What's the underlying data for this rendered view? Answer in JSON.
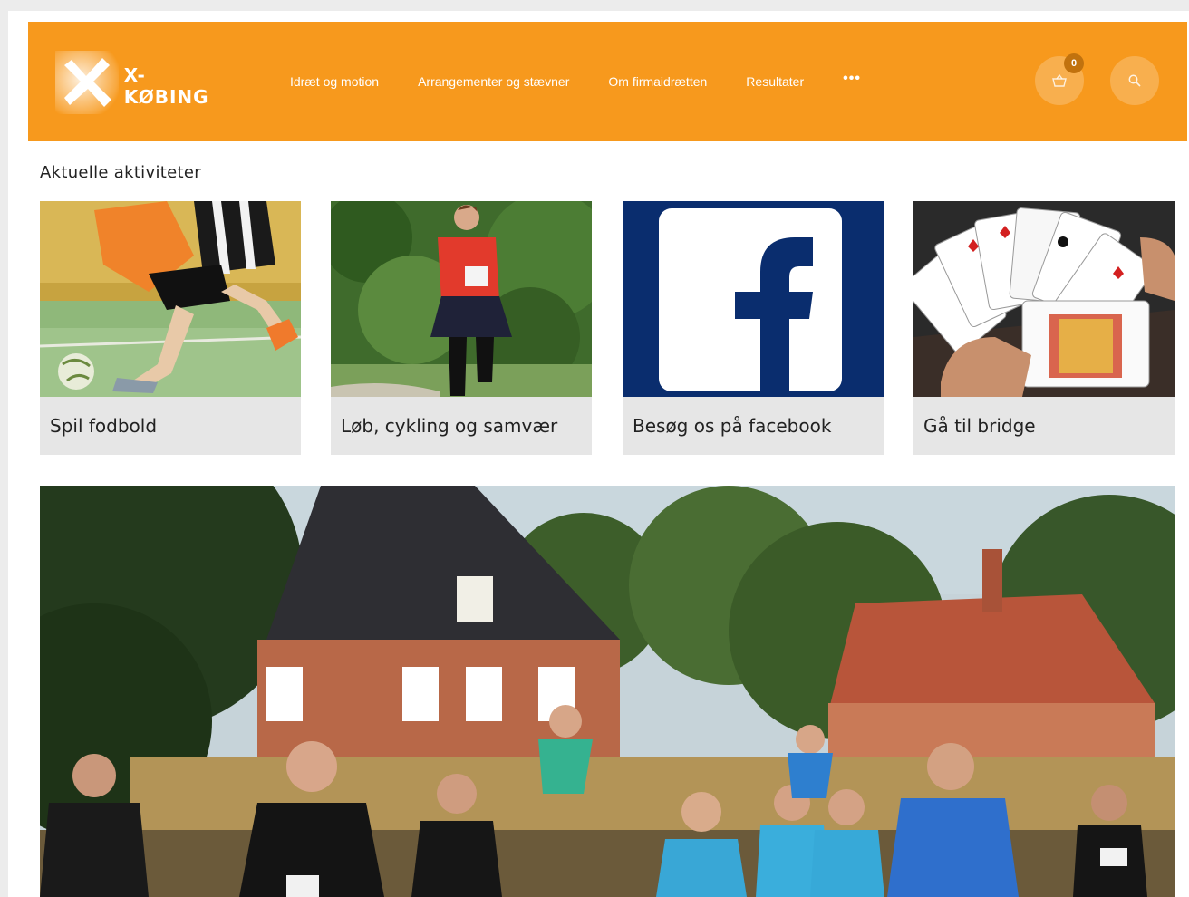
{
  "header": {
    "brand": "X-KØBING",
    "nav": [
      "Idræt og motion",
      "Arrangementer og stævner",
      "Om firmaidrætten",
      "Resultater"
    ],
    "more": "•••",
    "cart_count": "0"
  },
  "main": {
    "section_title": "Aktuelle aktiviteter",
    "cards": [
      {
        "caption": "Spil fodbold"
      },
      {
        "caption": "Løb, cykling og samvær"
      },
      {
        "caption": "Besøg os på facebook"
      },
      {
        "caption": "Gå til bridge"
      }
    ]
  },
  "colors": {
    "accent": "#f7991d",
    "facebook": "#0a2d6e"
  },
  "icons": {
    "cart": "basket-icon",
    "search": "search-icon",
    "logo": "x-logo-icon"
  }
}
